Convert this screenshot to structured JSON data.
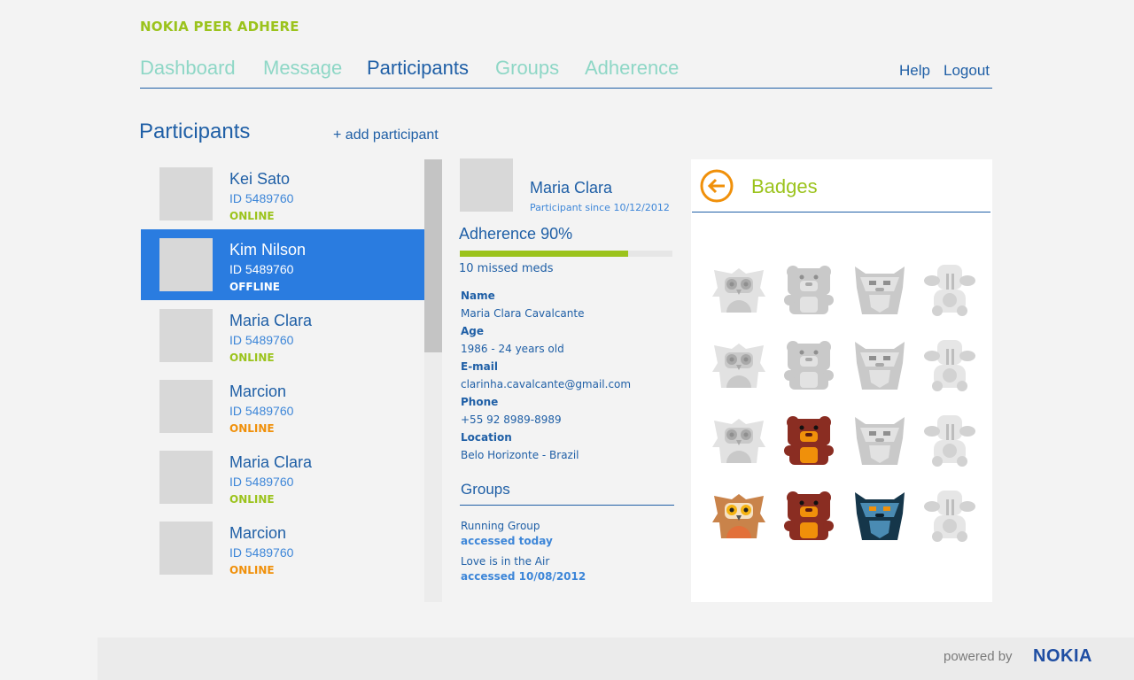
{
  "app": {
    "title": "NOKIA PEER ADHERE"
  },
  "nav": {
    "items": [
      {
        "label": "Dashboard"
      },
      {
        "label": "Message"
      },
      {
        "label": "Participants"
      },
      {
        "label": "Groups"
      },
      {
        "label": "Adherence"
      }
    ],
    "help": "Help",
    "logout": "Logout"
  },
  "participants": {
    "title": "Participants",
    "add_label": "+ add participant",
    "list": [
      {
        "name": "Kei Sato",
        "id": "ID 5489760",
        "status": "ONLINE",
        "status_color": "#9bc31c",
        "selected": false
      },
      {
        "name": "Kim Nilson",
        "id": "ID 5489760",
        "status": "OFFLINE",
        "status_color": "#ffffff",
        "selected": true
      },
      {
        "name": "Maria Clara",
        "id": "ID 5489760",
        "status": "ONLINE",
        "status_color": "#9bc31c",
        "selected": false
      },
      {
        "name": "Marcion",
        "id": "ID 5489760",
        "status": "ONLINE",
        "status_color": "#f0900a",
        "selected": false
      },
      {
        "name": "Maria Clara",
        "id": "ID 5489760",
        "status": "ONLINE",
        "status_color": "#9bc31c",
        "selected": false
      },
      {
        "name": "Marcion",
        "id": "ID 5489760",
        "status": "ONLINE",
        "status_color": "#f0900a",
        "selected": false
      }
    ]
  },
  "detail": {
    "name": "Maria Clara",
    "since": "Participant since 10/12/2012",
    "adherence_label": "Adherence 90%",
    "adherence_value": 0.79,
    "missed": "10 missed meds",
    "fields": [
      {
        "label": "Name",
        "value": "Maria Clara Cavalcante"
      },
      {
        "label": "Age",
        "value": "1986 - 24 years old"
      },
      {
        "label": "E-mail",
        "value": "clarinha.cavalcante@gmail.com"
      },
      {
        "label": "Phone",
        "value": "+55 92 8989-8989"
      },
      {
        "label": "Location",
        "value": "Belo Horizonte - Brazil"
      }
    ],
    "groups_title": "Groups",
    "groups": [
      {
        "name": "Running Group",
        "access": "accessed today"
      },
      {
        "name": "Love is in the Air",
        "access": "accessed 10/08/2012"
      }
    ]
  },
  "badges": {
    "title": "Badges",
    "accent": "#f0900a",
    "rows": [
      [
        {
          "type": "owl",
          "earned": false
        },
        {
          "type": "bear",
          "earned": false
        },
        {
          "type": "wolf",
          "earned": false
        },
        {
          "type": "walrus",
          "earned": false
        }
      ],
      [
        {
          "type": "owl",
          "earned": false
        },
        {
          "type": "bear",
          "earned": false
        },
        {
          "type": "wolf",
          "earned": false
        },
        {
          "type": "walrus",
          "earned": false
        }
      ],
      [
        {
          "type": "owl",
          "earned": false
        },
        {
          "type": "bear",
          "earned": true
        },
        {
          "type": "wolf",
          "earned": false
        },
        {
          "type": "walrus",
          "earned": false
        }
      ],
      [
        {
          "type": "owl",
          "earned": true
        },
        {
          "type": "bear",
          "earned": true
        },
        {
          "type": "wolf",
          "earned": true
        },
        {
          "type": "walrus",
          "earned": false
        }
      ]
    ]
  },
  "footer": {
    "powered": "powered by",
    "brand": "NOKIA"
  }
}
